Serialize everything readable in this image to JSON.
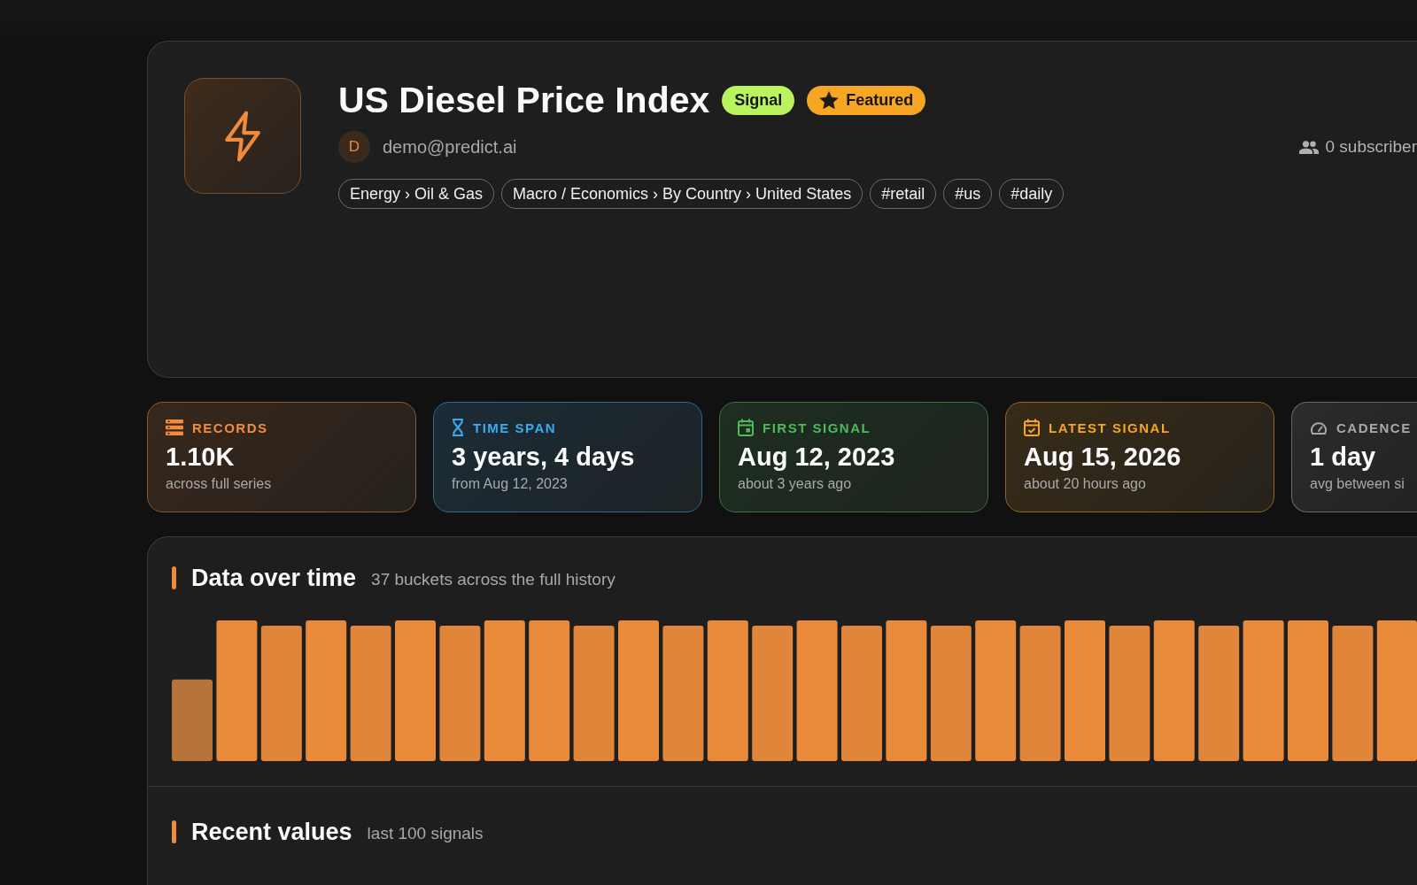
{
  "header": {
    "title": "US Diesel Price Index",
    "badges": [
      {
        "kind": "type",
        "label": "Signal"
      },
      {
        "kind": "featured",
        "label": "Featured"
      }
    ],
    "author": {
      "initial": "D",
      "email": "demo@predict.ai"
    },
    "subscribers": "0 subscriber",
    "tags": [
      "Energy › Oil & Gas",
      "Macro / Economics › By Country › United States",
      "#retail",
      "#us",
      "#daily"
    ]
  },
  "stats": [
    {
      "kind": "records",
      "label": "RECORDS",
      "value": "1.10K",
      "detail": "across full series",
      "color": "#f28c3c"
    },
    {
      "kind": "time_span",
      "label": "TIME SPAN",
      "value": "3 years, 4 days",
      "detail": "from Aug 12, 2023",
      "color": "#3aabf0"
    },
    {
      "kind": "first_signal",
      "label": "FIRST SIGNAL",
      "value": "Aug 12, 2023",
      "detail": "about 3 years ago",
      "color": "#4cbb5a"
    },
    {
      "kind": "latest_signal",
      "label": "LATEST SIGNAL",
      "value": "Aug 15, 2026",
      "detail": "about 20 hours ago",
      "color": "#f5a623"
    },
    {
      "kind": "cadence",
      "label": "CADENCE",
      "value": "1 day",
      "detail": "avg between si",
      "color": "#a8a8a8"
    }
  ],
  "activity": {
    "title": "Data over time",
    "subtitle": "37 buckets across the full history"
  },
  "recent": {
    "title": "Recent values",
    "subtitle": "last 100 signals"
  }
}
